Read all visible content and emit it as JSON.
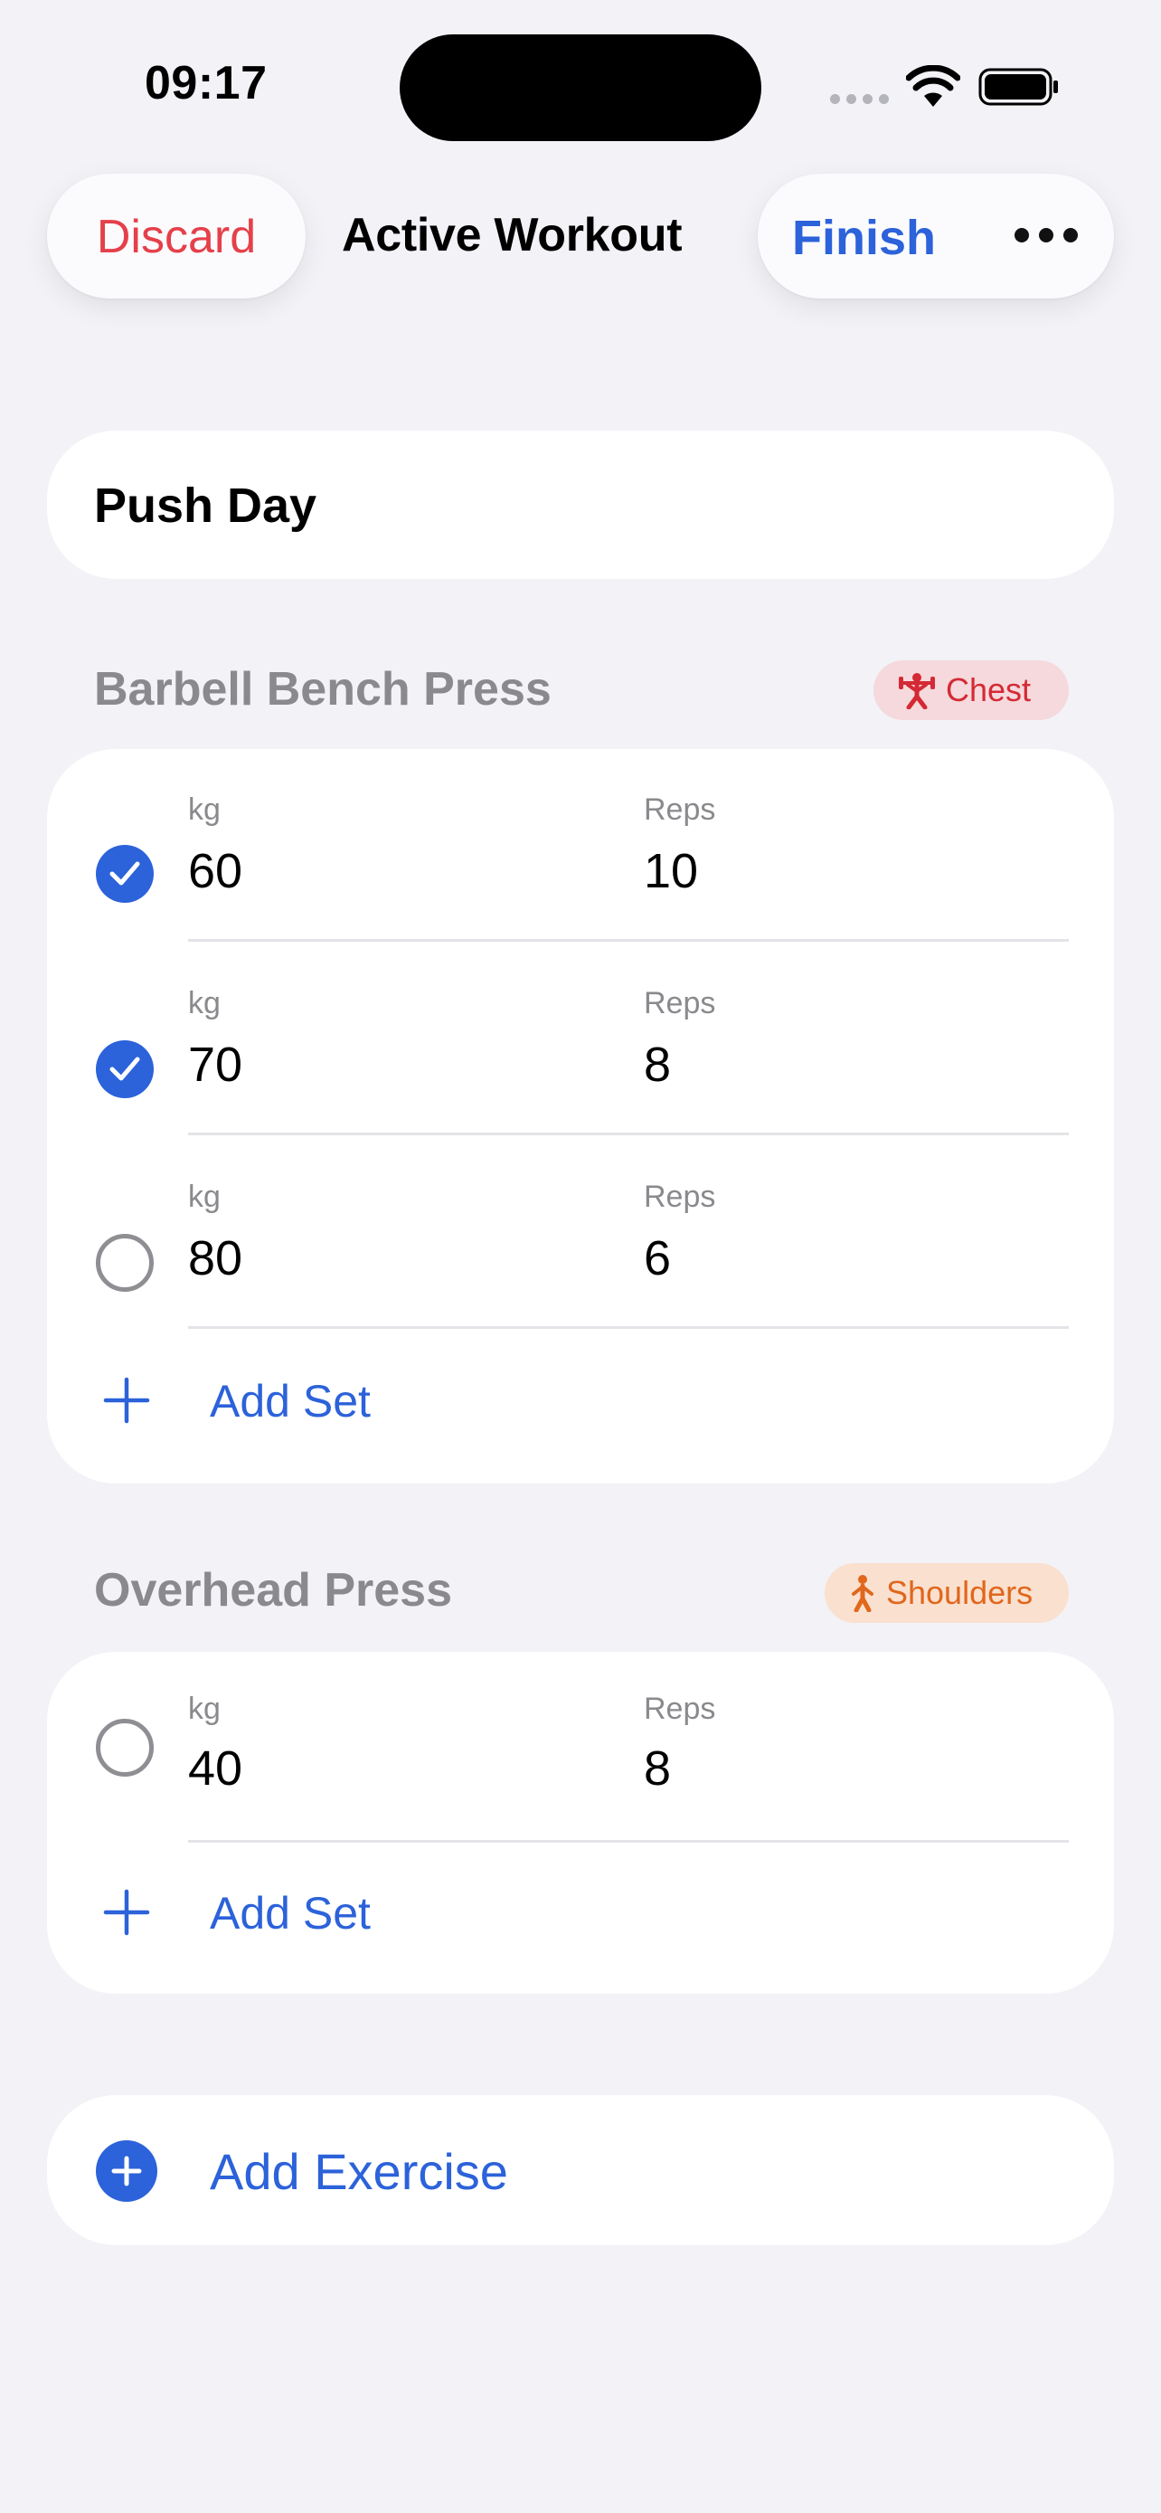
{
  "status_bar": {
    "time": "09:17"
  },
  "nav": {
    "discard_label": "Discard",
    "title": "Active Workout",
    "finish_label": "Finish"
  },
  "workout": {
    "name": "Push Day"
  },
  "exercises": [
    {
      "name": "Barbell Bench Press",
      "muscle": "Chest",
      "muscle_color": "#d42a35",
      "weight_label": "kg",
      "reps_label": "Reps",
      "sets": [
        {
          "completed": true,
          "weight": "60",
          "reps": "10"
        },
        {
          "completed": true,
          "weight": "70",
          "reps": "8"
        },
        {
          "completed": false,
          "weight": "80",
          "reps": "6"
        }
      ],
      "add_set_label": "Add Set"
    },
    {
      "name": "Overhead Press",
      "muscle": "Shoulders",
      "muscle_color": "#e0671c",
      "weight_label": "kg",
      "reps_label": "Reps",
      "sets": [
        {
          "completed": false,
          "weight": "40",
          "reps": "8"
        }
      ],
      "add_set_label": "Add Set"
    }
  ],
  "add_exercise_label": "Add Exercise",
  "colors": {
    "accent": "#2c62da",
    "destructive": "#e5404a",
    "background": "#f2f2f7"
  }
}
